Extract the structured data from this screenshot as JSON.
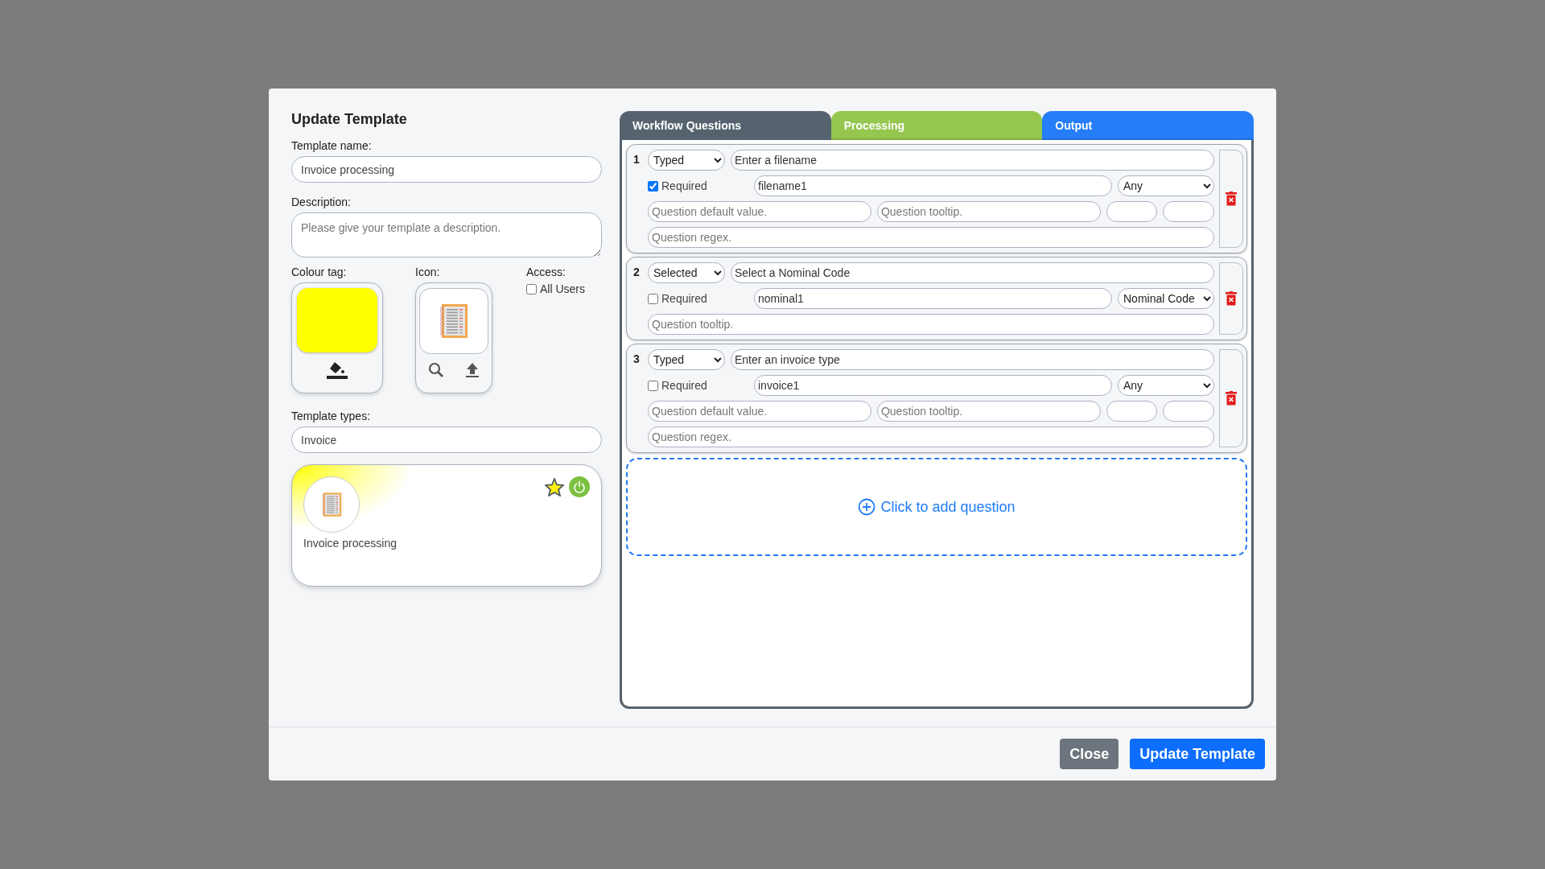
{
  "dialog": {
    "title": "Update Template",
    "template_name": {
      "label": "Template name:",
      "value": "Invoice processing"
    },
    "description": {
      "label": "Description:",
      "placeholder": "Please give your template a description."
    },
    "colour_tag": {
      "label": "Colour tag:",
      "color": "#ffff00"
    },
    "icon": {
      "label": "Icon:"
    },
    "access": {
      "label": "Access:",
      "option": "All Users",
      "checked": false
    },
    "template_types": {
      "label": "Template types:",
      "value": "Invoice"
    },
    "preview": {
      "name": "Invoice processing",
      "favourite": true,
      "enabled": true
    },
    "tabs": [
      {
        "label": "Workflow Questions",
        "selected": true,
        "color": "#56636f"
      },
      {
        "label": "Processing",
        "selected": false,
        "color": "#92c64a"
      },
      {
        "label": "Output",
        "selected": false,
        "color": "#1f7af8"
      }
    ],
    "questions": [
      {
        "number": "1",
        "kind": "typed",
        "type": "Typed",
        "prompt": "Enter a filename",
        "required": true,
        "required_label": "Required",
        "variable": "filename1",
        "constraint": "Any",
        "default_placeholder": "Question default value.",
        "tooltip_placeholder": "Question tooltip.",
        "regex_placeholder": "Question regex."
      },
      {
        "number": "2",
        "kind": "selected",
        "type": "Selected",
        "prompt": "Select a Nominal Code",
        "required": false,
        "required_label": "Required",
        "variable": "nominal1",
        "constraint": "Nominal Code",
        "tooltip_placeholder": "Question tooltip."
      },
      {
        "number": "3",
        "kind": "typed",
        "type": "Typed",
        "prompt": "Enter an invoice type",
        "required": false,
        "required_label": "Required",
        "variable": "invoice1",
        "constraint": "Any",
        "default_placeholder": "Question default value.",
        "tooltip_placeholder": "Question tooltip.",
        "regex_placeholder": "Question regex."
      }
    ],
    "add_question": "Click to add question",
    "buttons": [
      {
        "label": "Close",
        "kind": "secondary"
      },
      {
        "label": "Update Template",
        "kind": "primary"
      }
    ]
  }
}
